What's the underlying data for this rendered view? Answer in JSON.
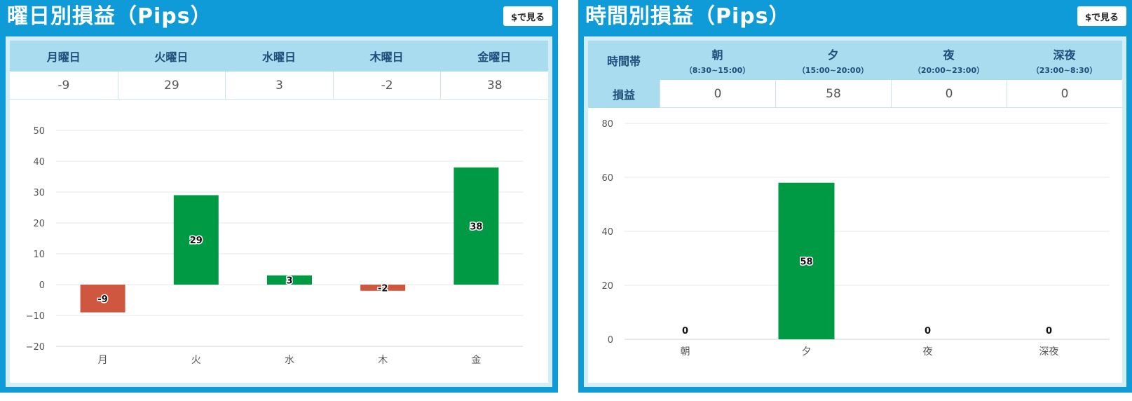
{
  "colors": {
    "positive": "#009a44",
    "negative": "#d0573f",
    "header_bg": "#0e9bd8",
    "table_head": "#a9dcee"
  },
  "left": {
    "title": "曜日別損益（Pips）",
    "button": "$で見る",
    "table": {
      "headers": [
        "月曜日",
        "火曜日",
        "水曜日",
        "木曜日",
        "金曜日"
      ],
      "values": [
        "-9",
        "29",
        "3",
        "-2",
        "38"
      ]
    }
  },
  "right": {
    "title": "時間別損益（Pips）",
    "button": "$で見る",
    "table": {
      "corner": "時間帯",
      "row_label": "損益",
      "headers": [
        {
          "name": "朝",
          "range": "（8:30~15:00）"
        },
        {
          "name": "夕",
          "range": "（15:00~20:00）"
        },
        {
          "name": "夜",
          "range": "（20:00~23:00）"
        },
        {
          "name": "深夜",
          "range": "（23:00~8:30）"
        }
      ],
      "values": [
        "0",
        "58",
        "0",
        "0"
      ]
    }
  },
  "chart_data": [
    {
      "type": "bar",
      "categories": [
        "月",
        "火",
        "水",
        "木",
        "金"
      ],
      "values": [
        -9,
        29,
        3,
        -2,
        38
      ],
      "ylim": [
        -20,
        50
      ],
      "yticks": [
        50,
        40,
        30,
        20,
        10,
        0,
        -10,
        -20
      ],
      "ytick_labels": [
        "50",
        "40",
        "30",
        "20",
        "10",
        "0",
        "−10",
        "−20"
      ],
      "data_labels": [
        "-9",
        "29",
        "3",
        "-2",
        "38"
      ],
      "grid": true
    },
    {
      "type": "bar",
      "categories": [
        "朝",
        "夕",
        "夜",
        "深夜"
      ],
      "values": [
        0,
        58,
        0,
        0
      ],
      "ylim": [
        0,
        80
      ],
      "yticks": [
        80,
        60,
        40,
        20,
        0
      ],
      "ytick_labels": [
        "80",
        "60",
        "40",
        "20",
        "0"
      ],
      "data_labels": [
        "0",
        "58",
        "0",
        "0"
      ],
      "grid": true
    }
  ]
}
